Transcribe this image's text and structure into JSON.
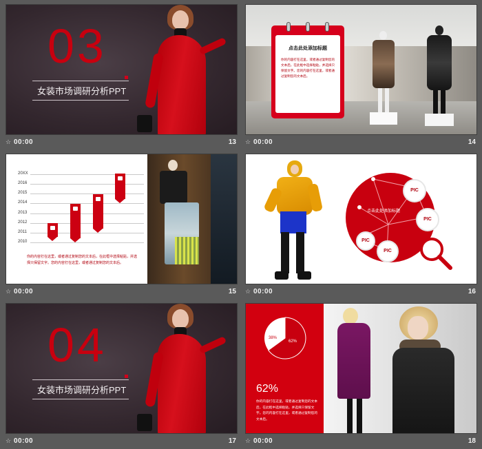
{
  "slides": [
    {
      "number": "13",
      "time": "00:00",
      "big_number": "03",
      "title": "女装市场调研分析PPT"
    },
    {
      "number": "14",
      "time": "00:00",
      "note_title": "点击此处添加标题",
      "note_body": "你的内容打在这里，或者通过复制您的文本后，在此框中选择粘贴，并选择只保留文字。您的内容打在这里，或者通过复制您的文本后。"
    },
    {
      "number": "15",
      "time": "00:00",
      "y_labels": [
        "20XX",
        "2016",
        "2015",
        "2014",
        "2013",
        "2012",
        "2011",
        "2010"
      ],
      "body": "你的内容打在这里，或者通过复制您的文本后，在此框中选择粘贴，并选择只保留文字。您的内容打在这里，或者通过复制您的文本后。"
    },
    {
      "number": "16",
      "time": "00:00",
      "center_text": "点击此处添加标题",
      "pic_labels": [
        "PIC",
        "PIC",
        "PIC",
        "PIC"
      ]
    },
    {
      "number": "17",
      "time": "00:00",
      "big_number": "04",
      "title": "女装市场调研分析PPT"
    },
    {
      "number": "18",
      "time": "00:00",
      "percent": "62%",
      "pie_small": "38%",
      "pie_big": "62%",
      "body": "你的内容打在这里，或者通过复制您的文本后，在此框中选择粘贴，并选择只保留文字。您的内容打在这里，或者通过复制您的文本后。"
    }
  ],
  "footer_icon": "star-icon",
  "colors": {
    "accent": "#c8000f",
    "background": "#5a5a5a"
  }
}
